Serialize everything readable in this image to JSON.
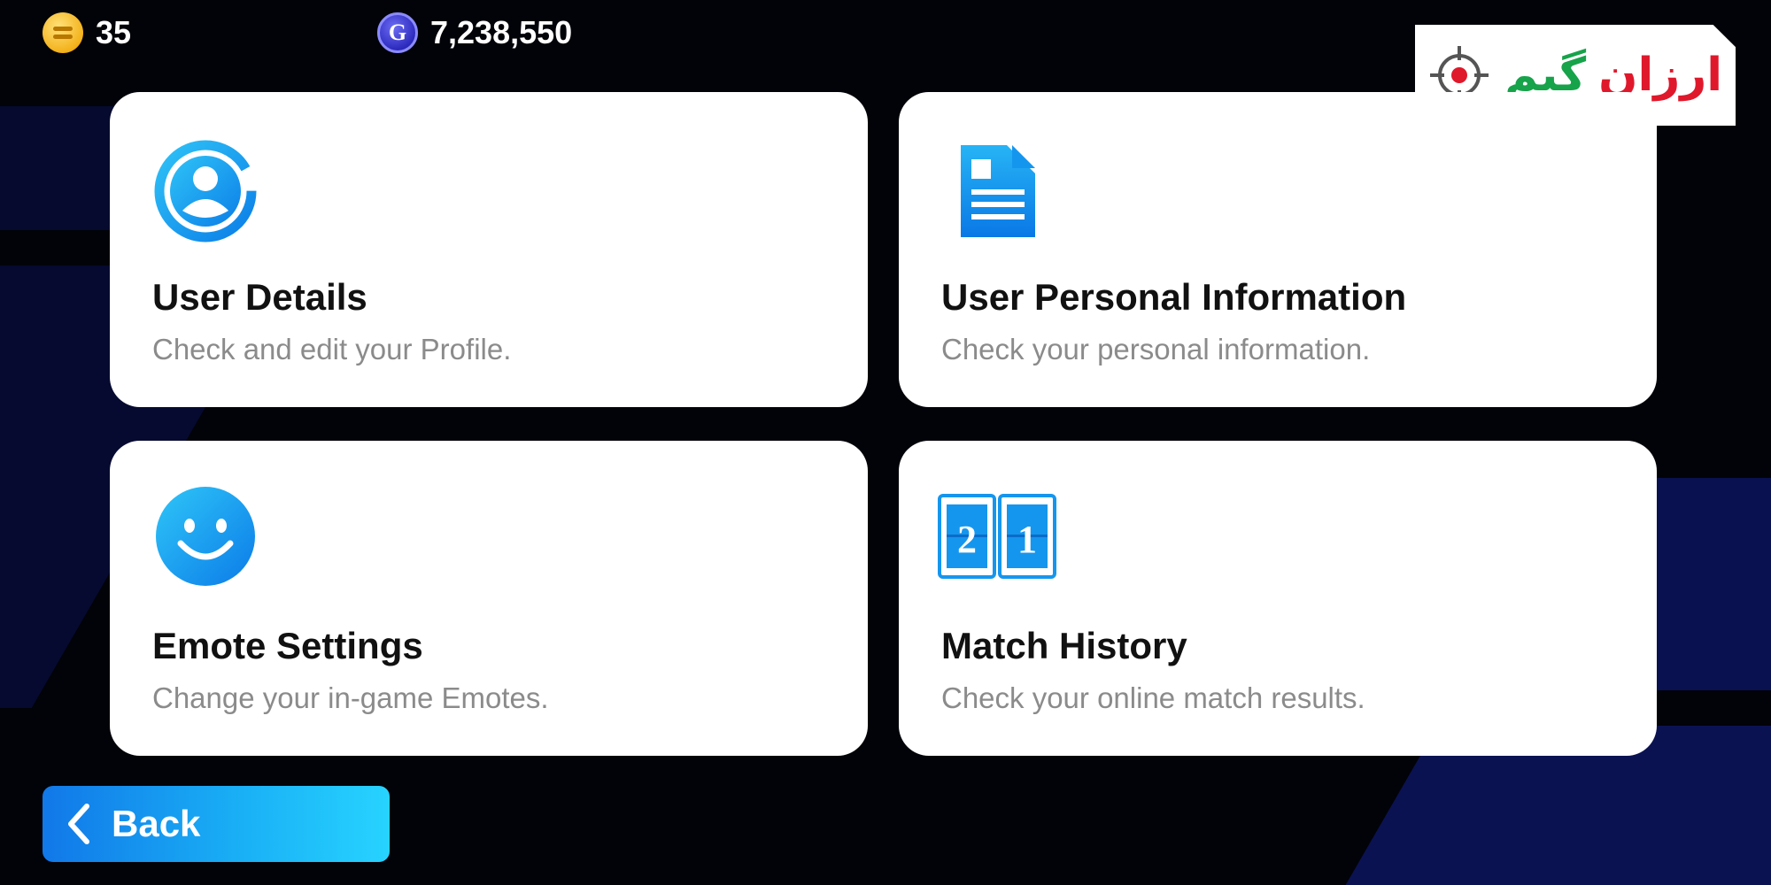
{
  "topbar": {
    "coins": "35",
    "gp": "7,238,550",
    "gp_icon_letter": "G"
  },
  "logo": {
    "word_red": "ارزان",
    "word_green": "گیم",
    "icon": "crosshair-icon"
  },
  "cards": [
    {
      "title": "User Details",
      "description": "Check and edit your Profile.",
      "icon": "user-profile-icon"
    },
    {
      "title": "User Personal Information",
      "description": "Check your personal information.",
      "icon": "document-icon"
    },
    {
      "title": "Emote Settings",
      "description": "Change your in-game Emotes.",
      "icon": "smiley-face-icon"
    },
    {
      "title": "Match History",
      "description": "Check your online match results.",
      "icon": "scoreboard-icon",
      "score_left": "2",
      "score_right": "1"
    }
  ],
  "back_button": {
    "label": "Back",
    "icon": "chevron-left-icon"
  },
  "colors": {
    "accent_blue": "#1a9af0",
    "logo_red": "#e0182b",
    "logo_green": "#16a34a",
    "background": "#020308"
  }
}
